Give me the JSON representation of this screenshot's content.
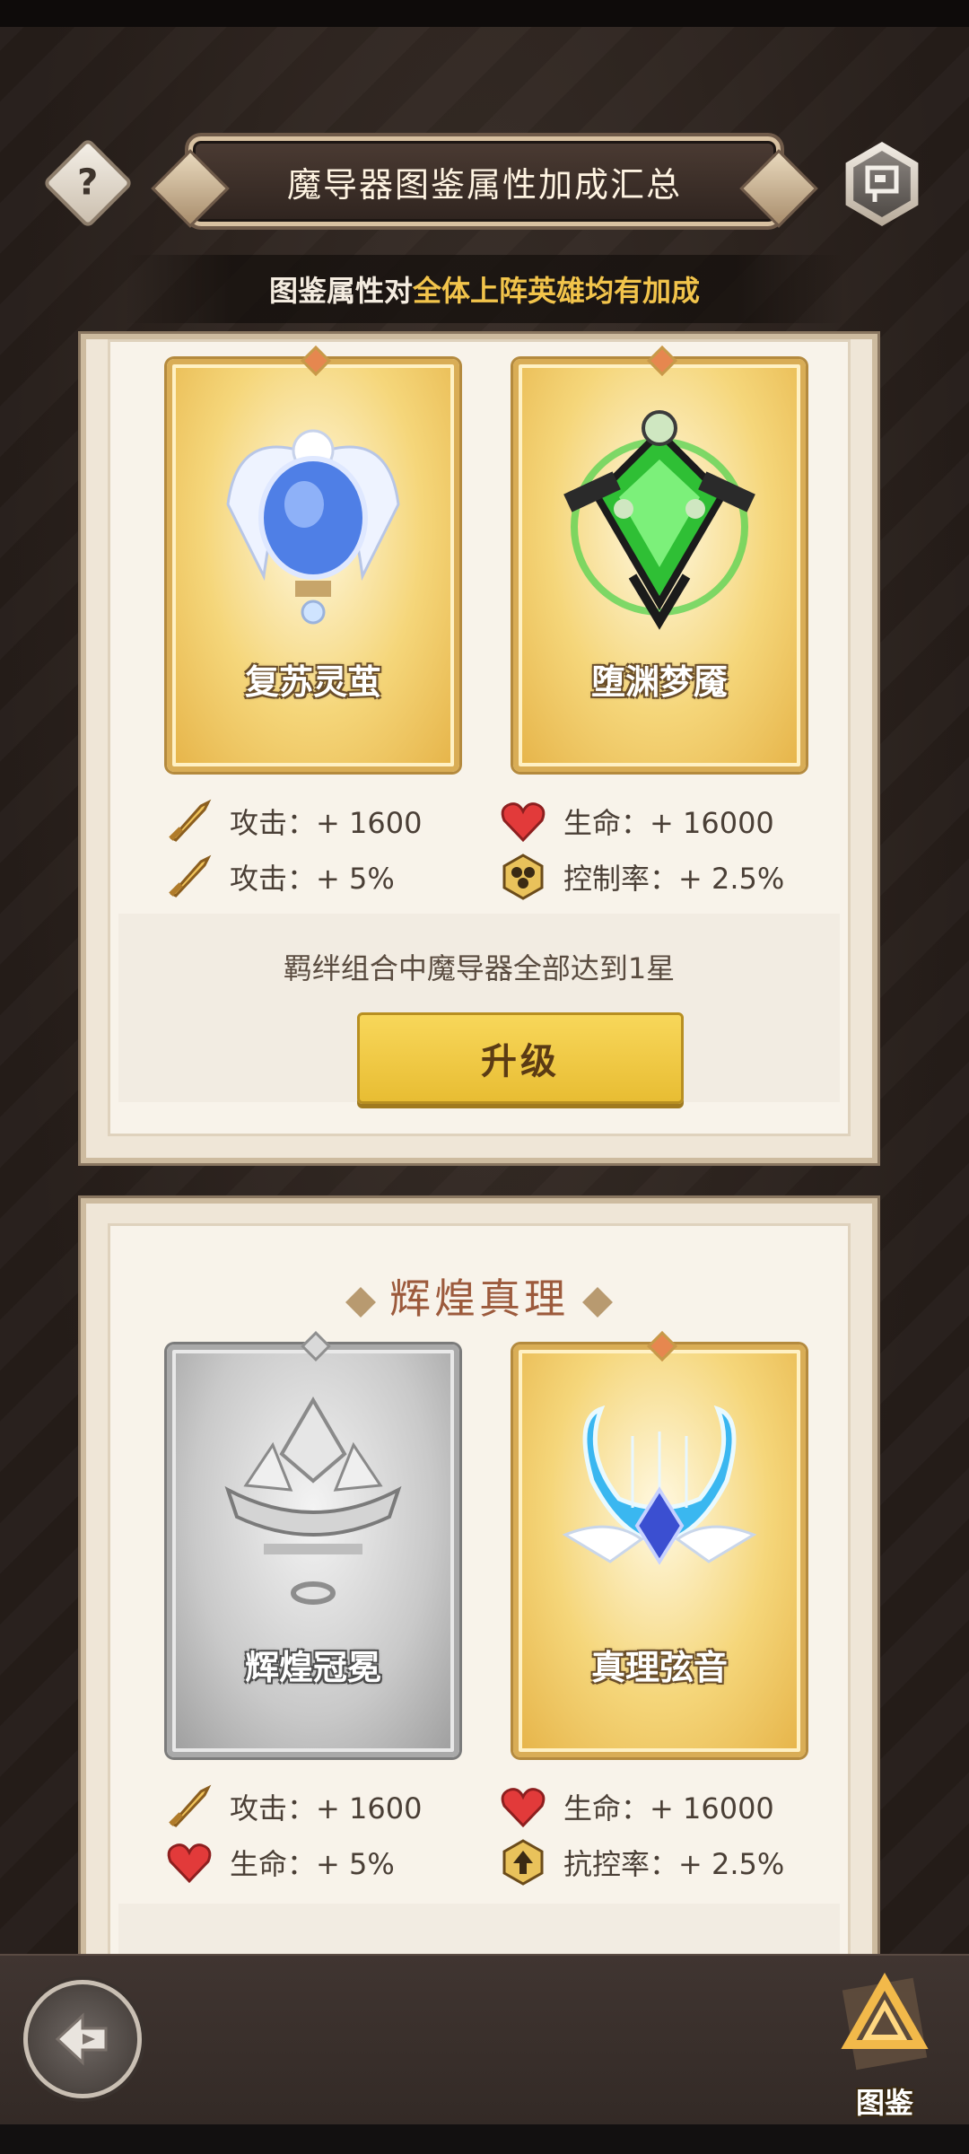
{
  "header": {
    "help_symbol": "?",
    "title": "魔导器图鉴属性加成汇总",
    "subtitle_prefix": "图鉴属性对",
    "subtitle_highlight": "全体上阵英雄均有加成"
  },
  "set1": {
    "cards": [
      {
        "name": "复苏灵茧",
        "rarity": "gold"
      },
      {
        "name": "堕渊梦魇",
        "rarity": "gold"
      }
    ],
    "stats": [
      {
        "icon": "sword-icon",
        "label": "攻击：+ 1600"
      },
      {
        "icon": "heart-icon",
        "label": "生命：+ 16000"
      },
      {
        "icon": "sword-icon",
        "label": "攻击：+ 5%"
      },
      {
        "icon": "control-icon",
        "label": "控制率：+ 2.5%"
      }
    ],
    "requirement": "羁绊组合中魔导器全部达到1星",
    "upgrade_label": "升级"
  },
  "set2": {
    "title": "辉煌真理",
    "cards": [
      {
        "name": "辉煌冠冕",
        "rarity": "silver"
      },
      {
        "name": "真理弦音",
        "rarity": "gold"
      }
    ],
    "stats": [
      {
        "icon": "sword-icon",
        "label": "攻击：+ 1600"
      },
      {
        "icon": "heart-icon",
        "label": "生命：+ 16000"
      },
      {
        "icon": "heart-icon",
        "label": "生命：+ 5%"
      },
      {
        "icon": "resist-control-icon",
        "label": "抗控率：+ 2.5%"
      }
    ]
  },
  "footer": {
    "codex_label": "图鉴"
  },
  "colors": {
    "accent_gold": "#f2c44b",
    "button_yellow": "#f8d75a",
    "set_title": "#9c5a3c"
  }
}
